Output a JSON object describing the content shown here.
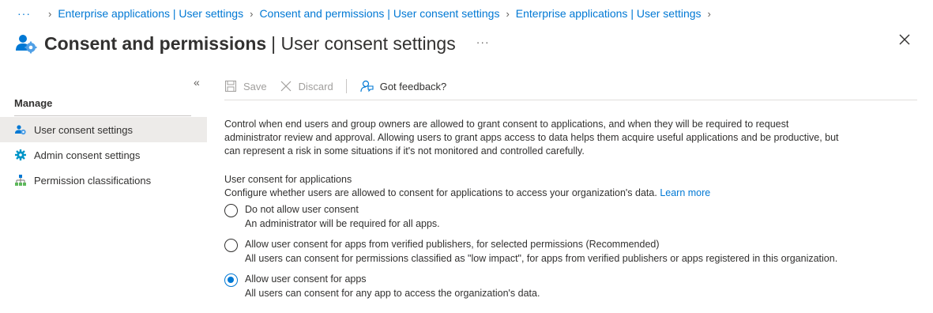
{
  "breadcrumb": {
    "more": "···",
    "items": [
      "Enterprise applications | User settings",
      "Consent and permissions | User consent settings",
      "Enterprise applications | User settings"
    ]
  },
  "header": {
    "title_strong": "Consent and permissions",
    "title_rest": "| User consent settings",
    "more": "···"
  },
  "sidebar": {
    "heading": "Manage",
    "items": [
      {
        "label": "User consent settings",
        "icon": "users-gear-icon",
        "active": true
      },
      {
        "label": "Admin consent settings",
        "icon": "gear-icon",
        "active": false
      },
      {
        "label": "Permission classifications",
        "icon": "hierarchy-icon",
        "active": false
      }
    ]
  },
  "toolbar": {
    "save_label": "Save",
    "discard_label": "Discard",
    "feedback_label": "Got feedback?"
  },
  "content": {
    "description_lines": [
      "Control when end users and group owners are allowed to grant consent to applications, and when they will be required to request",
      "administrator review and approval. Allowing users to grant apps access to data helps them acquire useful applications and be productive, but",
      "can represent a risk in some situations if it's not monitored and controlled carefully."
    ],
    "section_title": "User consent for applications",
    "section_subtitle": "Configure whether users are allowed to consent for applications to access your organization's data.",
    "learn_more": "Learn more",
    "options": [
      {
        "label": "Do not allow user consent",
        "description": "An administrator will be required for all apps.",
        "selected": false
      },
      {
        "label": "Allow user consent for apps from verified publishers, for selected permissions (Recommended)",
        "description": "All users can consent for permissions classified as \"low impact\", for apps from verified publishers or apps registered in this organization.",
        "selected": false
      },
      {
        "label": "Allow user consent for apps",
        "description": "All users can consent for any app to access the organization's data.",
        "selected": true
      }
    ]
  },
  "colors": {
    "accent": "#0078d4",
    "text": "#323130",
    "disabled": "#a19f9d",
    "active_bg": "#edebe9"
  }
}
